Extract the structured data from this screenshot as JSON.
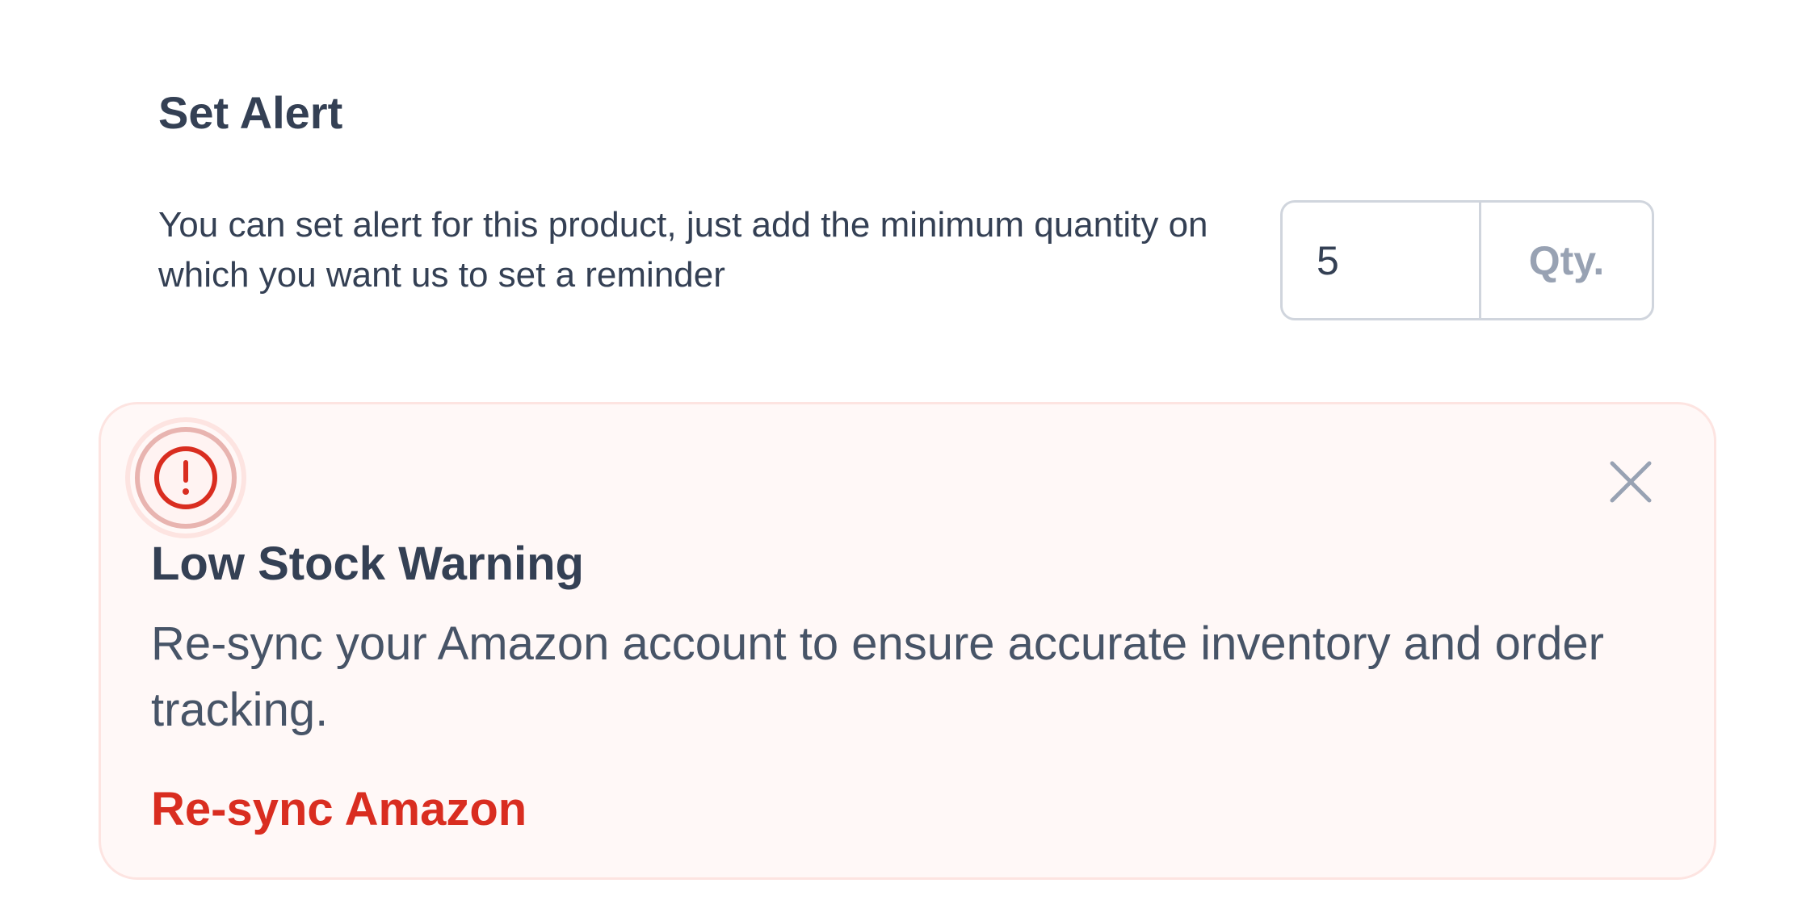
{
  "set_alert": {
    "title": "Set Alert",
    "description": "You can set alert for this product, just add the minimum quantity on which you want us to set a reminder",
    "quantity_value": "5",
    "quantity_unit": "Qty."
  },
  "warning": {
    "icon": "alert-circle-icon",
    "close_icon": "close-icon",
    "title": "Low Stock Warning",
    "message": "Re-sync your Amazon account to ensure accurate inventory and order tracking.",
    "action_label": "Re-sync Amazon"
  },
  "colors": {
    "text_primary": "#344054",
    "text_secondary": "#475467",
    "muted": "#98a2b3",
    "border": "#d0d5dd",
    "alert_background": "#fff8f7",
    "alert_border": "#fde4e1",
    "danger": "#d92d20"
  }
}
